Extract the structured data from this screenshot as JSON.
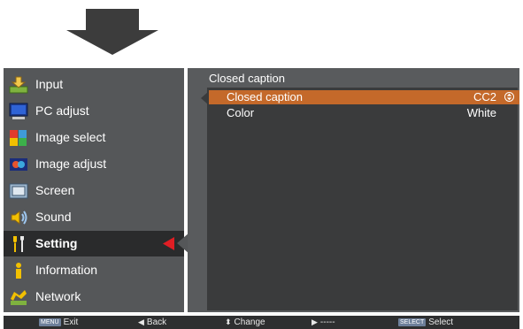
{
  "menu": {
    "items": [
      {
        "label": "Input",
        "icon": "input-icon"
      },
      {
        "label": "PC adjust",
        "icon": "pc-adjust-icon"
      },
      {
        "label": "Image select",
        "icon": "image-select-icon"
      },
      {
        "label": "Image adjust",
        "icon": "image-adjust-icon"
      },
      {
        "label": "Screen",
        "icon": "screen-icon"
      },
      {
        "label": "Sound",
        "icon": "sound-icon"
      },
      {
        "label": "Setting",
        "icon": "setting-icon",
        "selected": true
      },
      {
        "label": "Information",
        "icon": "information-icon"
      },
      {
        "label": "Network",
        "icon": "network-icon"
      }
    ]
  },
  "submenu": {
    "title": "Closed caption",
    "options": [
      {
        "label": "Closed caption",
        "value": "CC2",
        "highlighted": true
      },
      {
        "label": "Color",
        "value": "White",
        "highlighted": false
      }
    ]
  },
  "guide": {
    "exit_key": "MENU",
    "exit_label": "Exit",
    "back_label": "Back",
    "change_label": "Change",
    "next_label": "-----",
    "select_key": "SELECT",
    "select_label": "Select"
  },
  "colors": {
    "highlight": "#c4692a",
    "selection_arrow": "#e01e24",
    "panel": "#555759",
    "inner_panel": "#3a3b3c"
  }
}
